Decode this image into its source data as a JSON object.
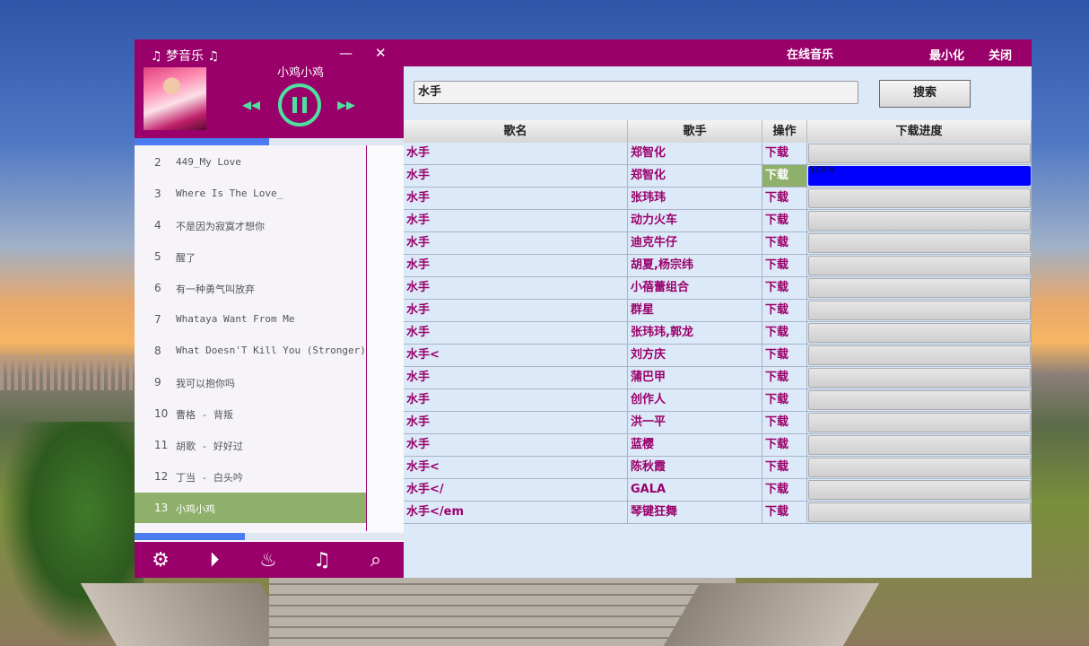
{
  "player": {
    "app_title": "♫ 梦音乐 ♫",
    "min_label": "—",
    "close_label": "✕",
    "now_playing": "小鸡小鸡",
    "prev_symbol": "◂◂",
    "next_symbol": "▸▸",
    "progress_percent": 50,
    "volume_percent": 41,
    "playlist": [
      {
        "num": "2",
        "name": "449_My Love"
      },
      {
        "num": "3",
        "name": "Where Is The Love_"
      },
      {
        "num": "4",
        "name": "不是因为寂寞才想你"
      },
      {
        "num": "5",
        "name": "醒了"
      },
      {
        "num": "6",
        "name": "有一种勇气叫放弃"
      },
      {
        "num": "7",
        "name": "Whataya Want From Me"
      },
      {
        "num": "8",
        "name": "What Doesn'T Kill You (Stronger)"
      },
      {
        "num": "9",
        "name": "我可以抱你吗"
      },
      {
        "num": "10",
        "name": "曹格 - 背叛"
      },
      {
        "num": "11",
        "name": "胡歌 - 好好过"
      },
      {
        "num": "12",
        "name": "丁当 - 白头吟"
      },
      {
        "num": "13",
        "name": "小鸡小鸡"
      }
    ],
    "active_index": 11,
    "footer_icons": [
      "gear-icon",
      "play-circle-icon",
      "flame-icon",
      "add-music-icon",
      "search-icon"
    ]
  },
  "online": {
    "title": "在线音乐",
    "minimize_label": "最小化",
    "close_label": "关闭",
    "search_value": "水手",
    "search_button": "搜索",
    "headers": [
      "歌名",
      "歌手",
      "操作",
      "下载进度"
    ],
    "rows": [
      {
        "song": "水手",
        "artist": "郑智化",
        "action": "下载",
        "progress": 0
      },
      {
        "song": "水手",
        "artist": "郑智化",
        "action": "下载",
        "progress": 100,
        "progress_text": "100%",
        "active": true
      },
      {
        "song": "水手",
        "artist": "张玮玮",
        "action": "下载",
        "progress": 0
      },
      {
        "song": "水手",
        "artist": "动力火车",
        "action": "下载",
        "progress": 0
      },
      {
        "song": "水手",
        "artist": "迪克牛仔",
        "action": "下载",
        "progress": 0
      },
      {
        "song": "水手",
        "artist": "胡夏,杨宗纬",
        "action": "下载",
        "progress": 0
      },
      {
        "song": "水手",
        "artist": "小蓓蕾组合",
        "action": "下载",
        "progress": 0
      },
      {
        "song": "水手",
        "artist": "群星",
        "action": "下载",
        "progress": 0
      },
      {
        "song": "水手",
        "artist": "张玮玮,郭龙",
        "action": "下载",
        "progress": 0
      },
      {
        "song": "水手<",
        "artist": "刘方庆",
        "action": "下载",
        "progress": 0
      },
      {
        "song": "水手",
        "artist": "蒲巴甲",
        "action": "下载",
        "progress": 0
      },
      {
        "song": "水手",
        "artist": "创作人",
        "action": "下载",
        "progress": 0
      },
      {
        "song": "水手",
        "artist": "洪一平",
        "action": "下载",
        "progress": 0
      },
      {
        "song": "水手",
        "artist": "蓝樱",
        "action": "下载",
        "progress": 0
      },
      {
        "song": "水手<",
        "artist": "陈秋霞",
        "action": "下载",
        "progress": 0
      },
      {
        "song": "水手</",
        "artist": "GALA",
        "action": "下载",
        "progress": 0
      },
      {
        "song": "水手</em",
        "artist": "琴键狂舞",
        "action": "下载",
        "progress": 0
      }
    ],
    "colors": {
      "accent": "#9a006a",
      "active_row": "#8fb06a",
      "progress_fill": "#0000ff"
    }
  }
}
